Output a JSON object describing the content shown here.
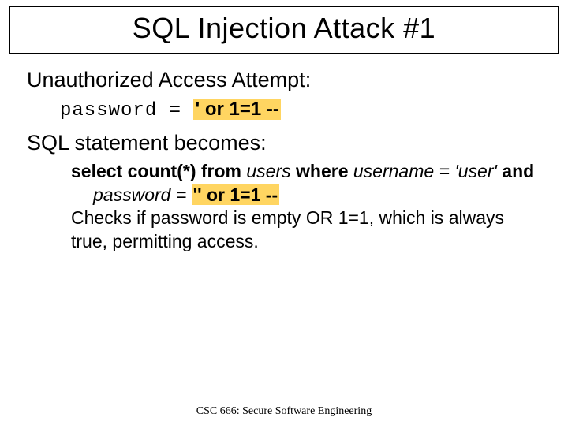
{
  "title": "SQL Injection Attack #1",
  "lead1": "Unauthorized Access Attempt:",
  "pw_label": "password = ",
  "pw_payload": "' or 1=1 --",
  "lead2": "SQL statement becomes:",
  "sql": {
    "p1a": "select count(*) from ",
    "p1b": "users ",
    "p1c": "where ",
    "p1d": "username = 'user' ",
    "p1e": "and ",
    "p1f": "password = ",
    "p1g": "'' or 1=1 --",
    "p2": "Checks if password is empty OR 1=1, which is always true, permitting access."
  },
  "footer": "CSC 666: Secure Software Engineering"
}
